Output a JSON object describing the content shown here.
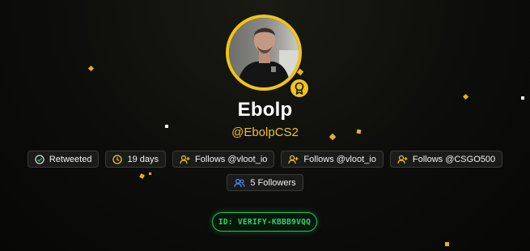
{
  "profile": {
    "name": "Ebolp",
    "handle": "@EbolpCS2",
    "avatar_icon": "profile-photo",
    "badge_icon": "award-ribbon-icon"
  },
  "chips": [
    {
      "label": "Retweeted",
      "icon": "check-circle-icon",
      "icon_color": "#22c55e"
    },
    {
      "label": "19 days",
      "icon": "clock-icon",
      "icon_color": "#f0c419"
    },
    {
      "label": "Follows @vloot_io",
      "icon": "user-plus-icon",
      "icon_color": "#f0c419"
    },
    {
      "label": "Follows @vloot_io",
      "icon": "user-plus-icon",
      "icon_color": "#f0c419"
    },
    {
      "label": "Follows @CSGO500",
      "icon": "user-plus-icon",
      "icon_color": "#f0c419"
    }
  ],
  "followers": {
    "label": "5 Followers",
    "icon": "users-icon",
    "icon_color": "#4f8df7"
  },
  "verify": {
    "label": "ID: VERIFY-KBBB9VQQ"
  },
  "colors": {
    "accent": "#f0c419",
    "success": "#22c55e",
    "background": "#0d0d0b"
  }
}
